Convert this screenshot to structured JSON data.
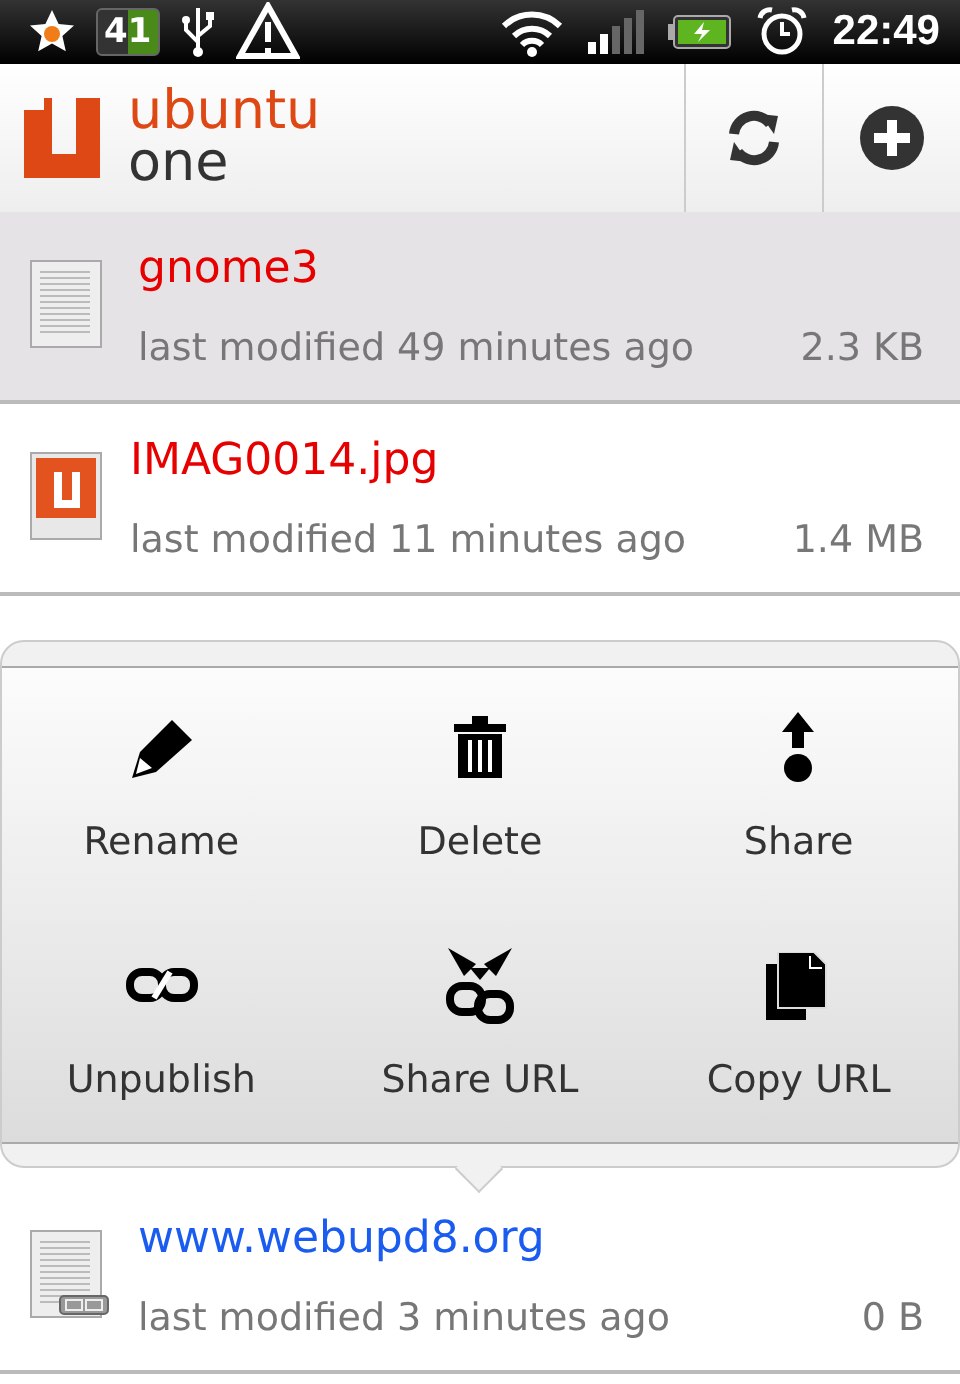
{
  "status_bar": {
    "battery_badge": "41",
    "time": "22:49"
  },
  "header": {
    "logo_top": "ubuntu",
    "logo_bottom": "one"
  },
  "files": [
    {
      "name": "gnome3",
      "modified": "last modified 49 minutes ago",
      "size": "2.3 KB",
      "kind": "document",
      "published": false,
      "selected": true
    },
    {
      "name": "IMAG0014.jpg",
      "modified": "last modified 11 minutes ago",
      "size": "1.4 MB",
      "kind": "image",
      "published": false,
      "selected": false
    }
  ],
  "context_menu": [
    {
      "label": "Rename"
    },
    {
      "label": "Delete"
    },
    {
      "label": "Share"
    },
    {
      "label": "Unpublish"
    },
    {
      "label": "Share URL"
    },
    {
      "label": "Copy URL"
    }
  ],
  "files_below": [
    {
      "name": "www.webupd8.org",
      "modified": "last modified 3 minutes ago",
      "size": "0 B",
      "kind": "document",
      "published": true,
      "selected": false
    }
  ]
}
